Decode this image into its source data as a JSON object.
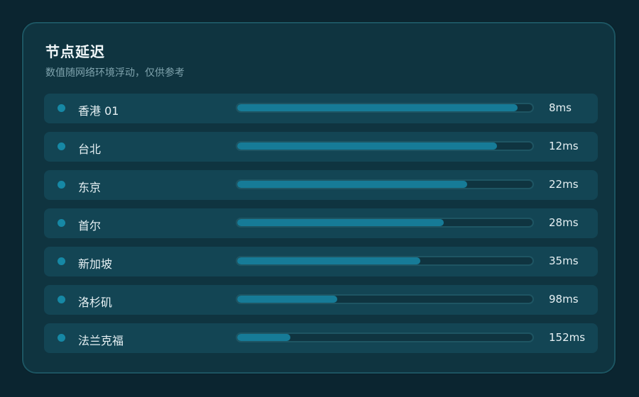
{
  "panel": {
    "title": "节点延迟",
    "subtitle": "数值随网络环境浮动，仅供参考"
  },
  "colors": {
    "accent": "#167b97",
    "dot": "#1688a5",
    "card_bg": "#0f3440",
    "row_bg": "#134554"
  },
  "nodes": [
    {
      "name": "香港 01",
      "latency": "8ms",
      "bar_level": 0.95
    },
    {
      "name": "台北",
      "latency": "12ms",
      "bar_level": 0.88
    },
    {
      "name": "东京",
      "latency": "22ms",
      "bar_level": 0.78
    },
    {
      "name": "首尔",
      "latency": "28ms",
      "bar_level": 0.7
    },
    {
      "name": "新加坡",
      "latency": "35ms",
      "bar_level": 0.62
    },
    {
      "name": "洛杉矶",
      "latency": "98ms",
      "bar_level": 0.34
    },
    {
      "name": "法兰克福",
      "latency": "152ms",
      "bar_level": 0.18
    }
  ]
}
